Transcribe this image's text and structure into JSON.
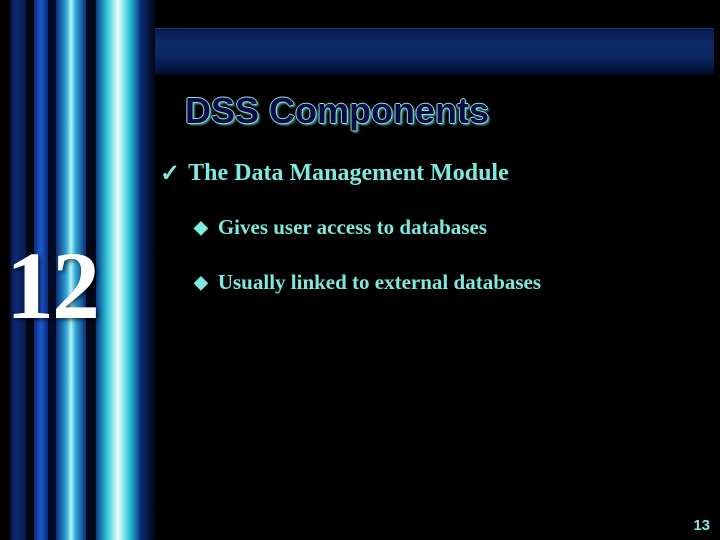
{
  "chapter_number": "12",
  "title": "DSS Components",
  "bullets": {
    "lvl1_check": "✓",
    "lvl1_text": "The Data Management Module",
    "lvl2_diamond": "◆",
    "lvl2_a": "Gives user access to databases",
    "lvl2_b": "Usually linked to external databases"
  },
  "page_number": "13"
}
